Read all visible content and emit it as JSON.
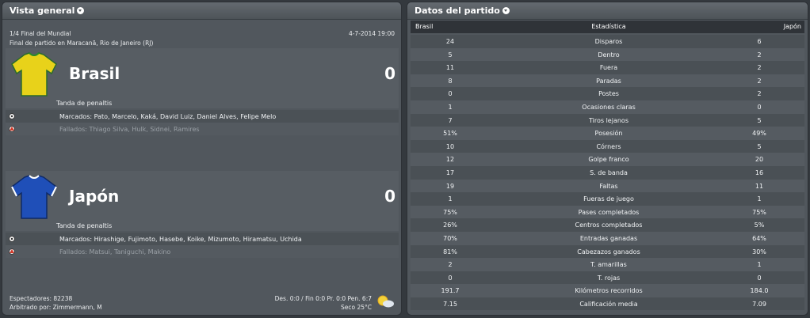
{
  "overview": {
    "title": "Vista general",
    "round": "1/4 Final del Mundial",
    "date": "4-7-2014 19:00",
    "venue": "Final de partido en Maracanã, Rio de Janeiro (RJ)",
    "home": {
      "name": "Brasil",
      "score": "0",
      "shirt_color": "#e8d21a",
      "penalties_label": "Tanda de penaltis",
      "scored": "Marcados: Pato, Marcelo, Kaká, David Luiz, Daniel Alves, Felipe Melo",
      "missed": "Fallados: Thiago Silva, Hulk, Sidnei, Ramires"
    },
    "away": {
      "name": "Japón",
      "score": "0",
      "shirt_color": "#1f4fb8",
      "penalties_label": "Tanda de penaltis",
      "scored": "Marcados: Hirashige, Fujimoto, Hasebe, Koike, Mizumoto, Hiramatsu, Uchida",
      "missed": "Fallados: Matsui, Taniguchi, Makino"
    },
    "spectators": "Espectadores: 82238",
    "referee": "Arbitrado por: Zimmermann, M",
    "extra": "Des. 0:0 / Fin 0:0 Pr. 0:0 Pen. 6:7",
    "weather": "Seco 25°C"
  },
  "stats": {
    "title": "Datos del partido",
    "header": {
      "home": "Brasil",
      "stat": "Estadística",
      "away": "Japón"
    },
    "rows": [
      {
        "home": "24",
        "label": "Disparos",
        "away": "6"
      },
      {
        "home": "5",
        "label": "Dentro",
        "away": "2"
      },
      {
        "home": "11",
        "label": "Fuera",
        "away": "2"
      },
      {
        "home": "8",
        "label": "Paradas",
        "away": "2"
      },
      {
        "home": "0",
        "label": "Postes",
        "away": "2"
      },
      {
        "home": "1",
        "label": "Ocasiones claras",
        "away": "0"
      },
      {
        "home": "7",
        "label": "Tiros lejanos",
        "away": "5"
      },
      {
        "home": "51%",
        "label": "Posesión",
        "away": "49%"
      },
      {
        "home": "10",
        "label": "Córners",
        "away": "5"
      },
      {
        "home": "12",
        "label": "Golpe franco",
        "away": "20"
      },
      {
        "home": "17",
        "label": "S. de banda",
        "away": "16"
      },
      {
        "home": "19",
        "label": "Faltas",
        "away": "11"
      },
      {
        "home": "1",
        "label": "Fueras de juego",
        "away": "1"
      },
      {
        "home": "75%",
        "label": "Pases completados",
        "away": "75%"
      },
      {
        "home": "26%",
        "label": "Centros completados",
        "away": "5%"
      },
      {
        "home": "70%",
        "label": "Entradas ganadas",
        "away": "64%"
      },
      {
        "home": "81%",
        "label": "Cabezazos ganados",
        "away": "30%"
      },
      {
        "home": "2",
        "label": "T. amarillas",
        "away": "1"
      },
      {
        "home": "0",
        "label": "T. rojas",
        "away": "0"
      },
      {
        "home": "191.7",
        "label": "Kilómetros recorridos",
        "away": "184.0"
      },
      {
        "home": "7.15",
        "label": "Calificación media",
        "away": "7.09"
      }
    ]
  }
}
